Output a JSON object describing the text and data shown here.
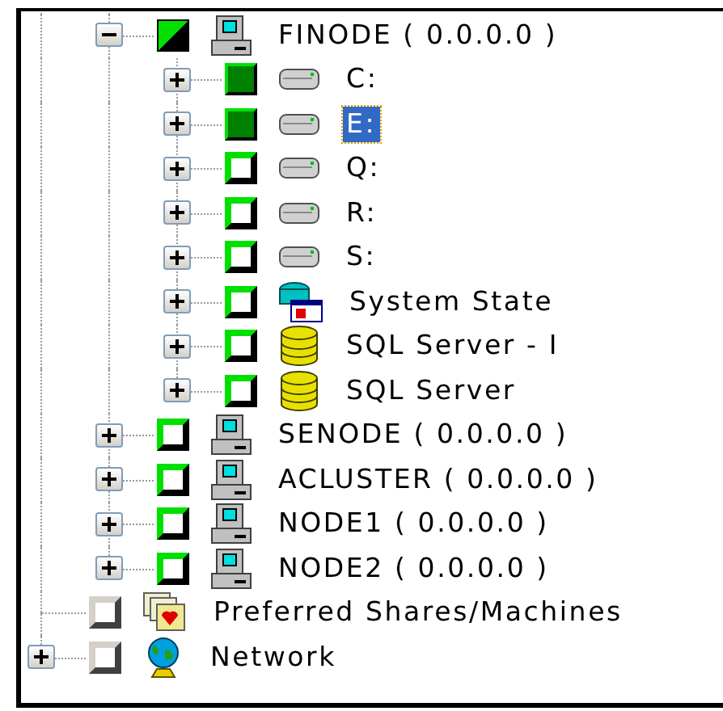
{
  "tree": {
    "continued_children": [
      {
        "label": "FINODE ( 0.0.0.0 )",
        "kind": "computer",
        "checked": true,
        "partial": true,
        "disabled": false,
        "expanded": true,
        "selected": false,
        "children": [
          {
            "label": "C:",
            "kind": "drive",
            "checked": true,
            "partial": false,
            "disabled": false,
            "expanded": false,
            "selected": false
          },
          {
            "label": "E:",
            "kind": "drive",
            "checked": true,
            "partial": false,
            "disabled": false,
            "expanded": false,
            "selected": true
          },
          {
            "label": "Q:",
            "kind": "drive",
            "checked": false,
            "partial": false,
            "disabled": false,
            "expanded": false,
            "selected": false
          },
          {
            "label": "R:",
            "kind": "drive",
            "checked": false,
            "partial": false,
            "disabled": false,
            "expanded": false,
            "selected": false
          },
          {
            "label": "S:",
            "kind": "drive",
            "checked": false,
            "partial": false,
            "disabled": false,
            "expanded": false,
            "selected": false
          },
          {
            "label": "System State",
            "kind": "system-state",
            "checked": false,
            "partial": false,
            "disabled": false,
            "expanded": false,
            "selected": false
          },
          {
            "label": "SQL Server - I",
            "kind": "database",
            "checked": false,
            "partial": false,
            "disabled": false,
            "expanded": false,
            "selected": false
          },
          {
            "label": "SQL Server",
            "kind": "database",
            "checked": false,
            "partial": false,
            "disabled": false,
            "expanded": false,
            "selected": false
          }
        ]
      },
      {
        "label": "SENODE ( 0.0.0.0 )",
        "kind": "computer",
        "checked": false,
        "partial": false,
        "disabled": false,
        "expanded": false,
        "selected": false
      },
      {
        "label": "ACLUSTER ( 0.0.0.0 )",
        "kind": "computer",
        "checked": false,
        "partial": false,
        "disabled": false,
        "expanded": false,
        "selected": false
      },
      {
        "label": "NODE1 ( 0.0.0.0 )",
        "kind": "computer",
        "checked": false,
        "partial": false,
        "disabled": false,
        "expanded": false,
        "selected": false
      },
      {
        "label": "NODE2 ( 0.0.0.0 )",
        "kind": "computer",
        "checked": false,
        "partial": false,
        "disabled": false,
        "expanded": false,
        "selected": false
      }
    ],
    "items": [
      {
        "label": "Preferred Shares/Machines",
        "kind": "shares",
        "checked": false,
        "partial": false,
        "disabled": true,
        "selected": false
      },
      {
        "label": "Network",
        "kind": "network",
        "checked": false,
        "partial": false,
        "disabled": true,
        "expanded": false,
        "selected": false
      }
    ]
  }
}
